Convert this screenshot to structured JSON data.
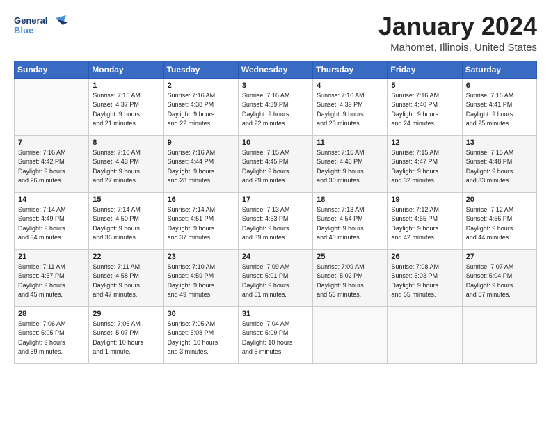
{
  "header": {
    "logo_line1": "General",
    "logo_line2": "Blue",
    "main_title": "January 2024",
    "subtitle": "Mahomet, Illinois, United States"
  },
  "calendar": {
    "days_of_week": [
      "Sunday",
      "Monday",
      "Tuesday",
      "Wednesday",
      "Thursday",
      "Friday",
      "Saturday"
    ],
    "weeks": [
      [
        {
          "day": "",
          "info": ""
        },
        {
          "day": "1",
          "info": "Sunrise: 7:15 AM\nSunset: 4:37 PM\nDaylight: 9 hours\nand 21 minutes."
        },
        {
          "day": "2",
          "info": "Sunrise: 7:16 AM\nSunset: 4:38 PM\nDaylight: 9 hours\nand 22 minutes."
        },
        {
          "day": "3",
          "info": "Sunrise: 7:16 AM\nSunset: 4:39 PM\nDaylight: 9 hours\nand 22 minutes."
        },
        {
          "day": "4",
          "info": "Sunrise: 7:16 AM\nSunset: 4:39 PM\nDaylight: 9 hours\nand 23 minutes."
        },
        {
          "day": "5",
          "info": "Sunrise: 7:16 AM\nSunset: 4:40 PM\nDaylight: 9 hours\nand 24 minutes."
        },
        {
          "day": "6",
          "info": "Sunrise: 7:16 AM\nSunset: 4:41 PM\nDaylight: 9 hours\nand 25 minutes."
        }
      ],
      [
        {
          "day": "7",
          "info": "Sunrise: 7:16 AM\nSunset: 4:42 PM\nDaylight: 9 hours\nand 26 minutes."
        },
        {
          "day": "8",
          "info": "Sunrise: 7:16 AM\nSunset: 4:43 PM\nDaylight: 9 hours\nand 27 minutes."
        },
        {
          "day": "9",
          "info": "Sunrise: 7:16 AM\nSunset: 4:44 PM\nDaylight: 9 hours\nand 28 minutes."
        },
        {
          "day": "10",
          "info": "Sunrise: 7:15 AM\nSunset: 4:45 PM\nDaylight: 9 hours\nand 29 minutes."
        },
        {
          "day": "11",
          "info": "Sunrise: 7:15 AM\nSunset: 4:46 PM\nDaylight: 9 hours\nand 30 minutes."
        },
        {
          "day": "12",
          "info": "Sunrise: 7:15 AM\nSunset: 4:47 PM\nDaylight: 9 hours\nand 32 minutes."
        },
        {
          "day": "13",
          "info": "Sunrise: 7:15 AM\nSunset: 4:48 PM\nDaylight: 9 hours\nand 33 minutes."
        }
      ],
      [
        {
          "day": "14",
          "info": "Sunrise: 7:14 AM\nSunset: 4:49 PM\nDaylight: 9 hours\nand 34 minutes."
        },
        {
          "day": "15",
          "info": "Sunrise: 7:14 AM\nSunset: 4:50 PM\nDaylight: 9 hours\nand 36 minutes."
        },
        {
          "day": "16",
          "info": "Sunrise: 7:14 AM\nSunset: 4:51 PM\nDaylight: 9 hours\nand 37 minutes."
        },
        {
          "day": "17",
          "info": "Sunrise: 7:13 AM\nSunset: 4:53 PM\nDaylight: 9 hours\nand 39 minutes."
        },
        {
          "day": "18",
          "info": "Sunrise: 7:13 AM\nSunset: 4:54 PM\nDaylight: 9 hours\nand 40 minutes."
        },
        {
          "day": "19",
          "info": "Sunrise: 7:12 AM\nSunset: 4:55 PM\nDaylight: 9 hours\nand 42 minutes."
        },
        {
          "day": "20",
          "info": "Sunrise: 7:12 AM\nSunset: 4:56 PM\nDaylight: 9 hours\nand 44 minutes."
        }
      ],
      [
        {
          "day": "21",
          "info": "Sunrise: 7:11 AM\nSunset: 4:57 PM\nDaylight: 9 hours\nand 45 minutes."
        },
        {
          "day": "22",
          "info": "Sunrise: 7:11 AM\nSunset: 4:58 PM\nDaylight: 9 hours\nand 47 minutes."
        },
        {
          "day": "23",
          "info": "Sunrise: 7:10 AM\nSunset: 4:59 PM\nDaylight: 9 hours\nand 49 minutes."
        },
        {
          "day": "24",
          "info": "Sunrise: 7:09 AM\nSunset: 5:01 PM\nDaylight: 9 hours\nand 51 minutes."
        },
        {
          "day": "25",
          "info": "Sunrise: 7:09 AM\nSunset: 5:02 PM\nDaylight: 9 hours\nand 53 minutes."
        },
        {
          "day": "26",
          "info": "Sunrise: 7:08 AM\nSunset: 5:03 PM\nDaylight: 9 hours\nand 55 minutes."
        },
        {
          "day": "27",
          "info": "Sunrise: 7:07 AM\nSunset: 5:04 PM\nDaylight: 9 hours\nand 57 minutes."
        }
      ],
      [
        {
          "day": "28",
          "info": "Sunrise: 7:06 AM\nSunset: 5:05 PM\nDaylight: 9 hours\nand 59 minutes."
        },
        {
          "day": "29",
          "info": "Sunrise: 7:06 AM\nSunset: 5:07 PM\nDaylight: 10 hours\nand 1 minute."
        },
        {
          "day": "30",
          "info": "Sunrise: 7:05 AM\nSunset: 5:08 PM\nDaylight: 10 hours\nand 3 minutes."
        },
        {
          "day": "31",
          "info": "Sunrise: 7:04 AM\nSunset: 5:09 PM\nDaylight: 10 hours\nand 5 minutes."
        },
        {
          "day": "",
          "info": ""
        },
        {
          "day": "",
          "info": ""
        },
        {
          "day": "",
          "info": ""
        }
      ]
    ]
  }
}
